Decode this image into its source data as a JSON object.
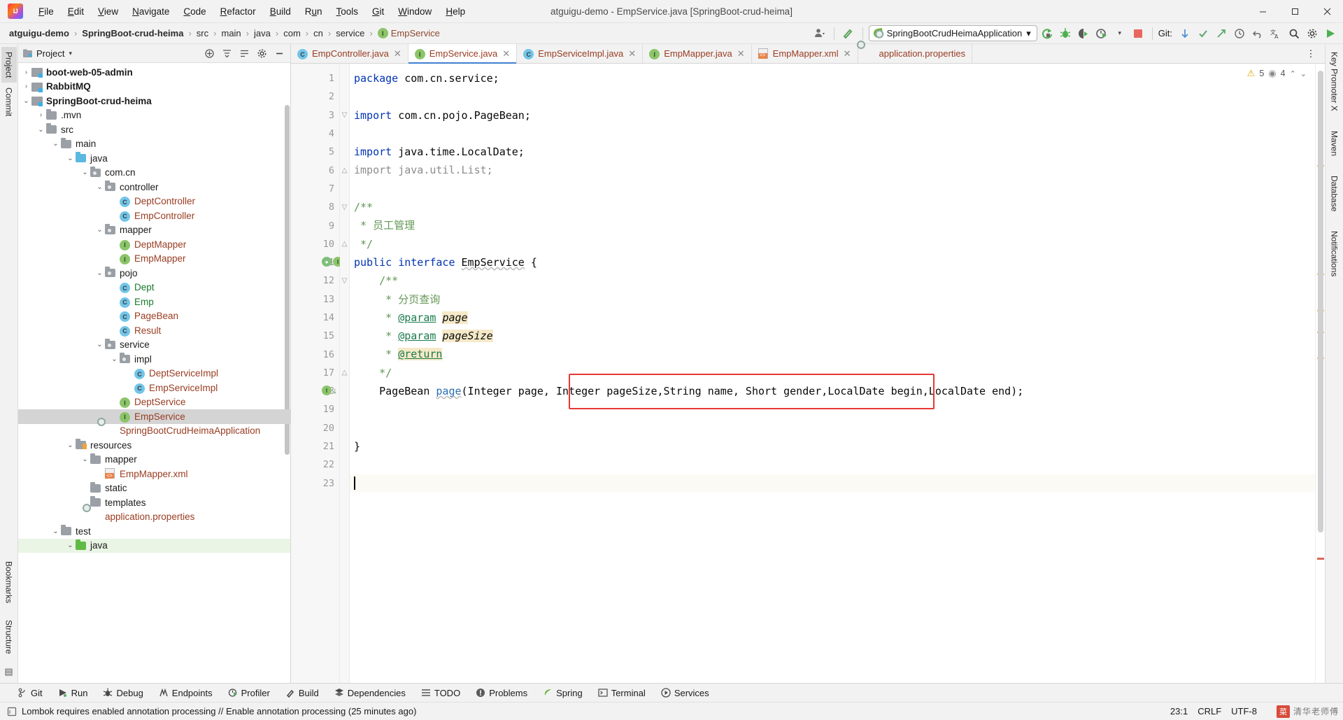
{
  "window": {
    "title": "atguigu-demo - EmpService.java [SpringBoot-crud-heima]",
    "minimize": "—",
    "maximize": "▢",
    "close": "✕"
  },
  "menubar": {
    "items": [
      {
        "label": "File",
        "mnemonic": "F"
      },
      {
        "label": "Edit",
        "mnemonic": "E"
      },
      {
        "label": "View",
        "mnemonic": "V"
      },
      {
        "label": "Navigate",
        "mnemonic": "N"
      },
      {
        "label": "Code",
        "mnemonic": "C"
      },
      {
        "label": "Refactor",
        "mnemonic": "R"
      },
      {
        "label": "Build",
        "mnemonic": "B"
      },
      {
        "label": "Run",
        "mnemonic": "u"
      },
      {
        "label": "Tools",
        "mnemonic": "T"
      },
      {
        "label": "Git",
        "mnemonic": "G"
      },
      {
        "label": "Window",
        "mnemonic": "W"
      },
      {
        "label": "Help",
        "mnemonic": "H"
      }
    ]
  },
  "navbar": {
    "crumbs": [
      {
        "label": "atguigu-demo",
        "bold": true,
        "icon": null
      },
      {
        "label": "SpringBoot-crud-heima",
        "bold": true,
        "icon": null
      },
      {
        "label": "src",
        "bold": false,
        "icon": null
      },
      {
        "label": "main",
        "bold": false,
        "icon": null
      },
      {
        "label": "java",
        "bold": false,
        "icon": null
      },
      {
        "label": "com",
        "bold": false,
        "icon": null
      },
      {
        "label": "cn",
        "bold": false,
        "icon": null
      },
      {
        "label": "service",
        "bold": false,
        "icon": null
      },
      {
        "label": "EmpService",
        "bold": false,
        "icon": "interface-badge",
        "classname": true
      }
    ],
    "separator": "›",
    "run_config": "SpringBootCrudHeimaApplication",
    "run_config_caret": "▾",
    "git_label": "Git:",
    "icons": {
      "user": "user-icon",
      "hammer": "build-hammer-icon",
      "rerun": "rerun-icon",
      "debug": "debug-bug-icon",
      "coverage": "run-with-coverage-icon",
      "profiler": "profiler-icon",
      "stop": "stop-icon",
      "git_update": "git-update-icon",
      "git_commit": "git-commit-check-icon",
      "git_push": "git-push-icon",
      "history": "history-icon",
      "undo": "undo-icon",
      "translate": "translate-icon",
      "search": "search-everywhere-icon",
      "settings": "settings-gear-icon",
      "run_green": "run-green-icon"
    }
  },
  "left_strip": {
    "tabs": [
      "Project",
      "Commit"
    ],
    "active": "Project",
    "bottom": [
      "Bookmarks",
      "Structure"
    ]
  },
  "right_strip": {
    "tabs": [
      "Key Promoter X",
      "Maven",
      "Database",
      "Notifications"
    ]
  },
  "project_panel": {
    "title": "Project",
    "caret": "▾",
    "header_icons": [
      "expand-all-icon",
      "collapse-all-icon",
      "select-opened-file-icon",
      "settings-gear-icon",
      "hide-icon"
    ],
    "tree": [
      {
        "label": "boot-web-05-admin",
        "depth": 1,
        "arrow": "›",
        "icon": "module",
        "style": "bold"
      },
      {
        "label": "RabbitMQ",
        "depth": 1,
        "arrow": "›",
        "icon": "module",
        "style": "bold"
      },
      {
        "label": "SpringBoot-crud-heima",
        "depth": 1,
        "arrow": "⌄",
        "icon": "module",
        "style": "bold"
      },
      {
        "label": ".mvn",
        "depth": 2,
        "arrow": "›",
        "icon": "folder",
        "style": "dark"
      },
      {
        "label": "src",
        "depth": 2,
        "arrow": "⌄",
        "icon": "folder",
        "style": "dark"
      },
      {
        "label": "main",
        "depth": 3,
        "arrow": "⌄",
        "icon": "folder",
        "style": "dark"
      },
      {
        "label": "java",
        "depth": 4,
        "arrow": "⌄",
        "icon": "folder-blue",
        "style": "dark"
      },
      {
        "label": "com.cn",
        "depth": 5,
        "arrow": "⌄",
        "icon": "package",
        "style": "dark"
      },
      {
        "label": "controller",
        "depth": 6,
        "arrow": "⌄",
        "icon": "package",
        "style": "dark"
      },
      {
        "label": "DeptController",
        "depth": 7,
        "arrow": "",
        "icon": "class",
        "style": "brown"
      },
      {
        "label": "EmpController",
        "depth": 7,
        "arrow": "",
        "icon": "class",
        "style": "brown"
      },
      {
        "label": "mapper",
        "depth": 6,
        "arrow": "⌄",
        "icon": "package",
        "style": "dark"
      },
      {
        "label": "DeptMapper",
        "depth": 7,
        "arrow": "",
        "icon": "interface",
        "style": "brown"
      },
      {
        "label": "EmpMapper",
        "depth": 7,
        "arrow": "",
        "icon": "interface",
        "style": "brown"
      },
      {
        "label": "pojo",
        "depth": 6,
        "arrow": "⌄",
        "icon": "package",
        "style": "dark"
      },
      {
        "label": "Dept",
        "depth": 7,
        "arrow": "",
        "icon": "class",
        "style": "green"
      },
      {
        "label": "Emp",
        "depth": 7,
        "arrow": "",
        "icon": "class",
        "style": "green"
      },
      {
        "label": "PageBean",
        "depth": 7,
        "arrow": "",
        "icon": "class",
        "style": "brown"
      },
      {
        "label": "Result",
        "depth": 7,
        "arrow": "",
        "icon": "class",
        "style": "brown"
      },
      {
        "label": "service",
        "depth": 6,
        "arrow": "⌄",
        "icon": "package",
        "style": "dark"
      },
      {
        "label": "impl",
        "depth": 7,
        "arrow": "⌄",
        "icon": "package",
        "style": "dark"
      },
      {
        "label": "DeptServiceImpl",
        "depth": 8,
        "arrow": "",
        "icon": "class",
        "style": "brown"
      },
      {
        "label": "EmpServiceImpl",
        "depth": 8,
        "arrow": "",
        "icon": "class",
        "style": "brown"
      },
      {
        "label": "DeptService",
        "depth": 7,
        "arrow": "",
        "icon": "interface",
        "style": "brown"
      },
      {
        "label": "EmpService",
        "depth": 7,
        "arrow": "",
        "icon": "interface",
        "style": "brown",
        "selected": true
      },
      {
        "label": "SpringBootCrudHeimaApplication",
        "depth": 6,
        "arrow": "",
        "icon": "spring",
        "style": "brown"
      },
      {
        "label": "resources",
        "depth": 4,
        "arrow": "⌄",
        "icon": "resources",
        "style": "dark"
      },
      {
        "label": "mapper",
        "depth": 5,
        "arrow": "⌄",
        "icon": "folder",
        "style": "dark"
      },
      {
        "label": "EmpMapper.xml",
        "depth": 6,
        "arrow": "",
        "icon": "xml",
        "style": "brown"
      },
      {
        "label": "static",
        "depth": 5,
        "arrow": "",
        "icon": "folder",
        "style": "dark"
      },
      {
        "label": "templates",
        "depth": 5,
        "arrow": "",
        "icon": "folder",
        "style": "dark"
      },
      {
        "label": "application.properties",
        "depth": 5,
        "arrow": "",
        "icon": "spring",
        "style": "brown"
      },
      {
        "label": "test",
        "depth": 3,
        "arrow": "⌄",
        "icon": "folder",
        "style": "dark"
      },
      {
        "label": "java",
        "depth": 4,
        "arrow": "⌄",
        "icon": "folder-green",
        "style": "dark",
        "green_row": true
      }
    ]
  },
  "editor": {
    "tabs": [
      {
        "label": "EmpController.java",
        "icon": "class",
        "active": false,
        "close": "✕"
      },
      {
        "label": "EmpService.java",
        "icon": "interface",
        "active": true,
        "close": "✕"
      },
      {
        "label": "EmpServiceImpl.java",
        "icon": "class",
        "active": false,
        "close": "✕"
      },
      {
        "label": "EmpMapper.java",
        "icon": "interface",
        "active": false,
        "close": "✕"
      },
      {
        "label": "EmpMapper.xml",
        "icon": "xml",
        "active": false,
        "close": "✕"
      },
      {
        "label": "application.properties",
        "icon": "spring",
        "active": false,
        "close": ""
      }
    ],
    "more_icon": "⋮",
    "inspections": {
      "warning_icon": "⚠",
      "warning_count": "5",
      "weak_icon": "◉",
      "weak_count": "4",
      "up_arrow": "⌃",
      "down_arrow": "⌄"
    },
    "line_numbers": [
      "1",
      "2",
      "3",
      "4",
      "5",
      "6",
      "7",
      "8",
      "9",
      "10",
      "11",
      "12",
      "13",
      "14",
      "15",
      "16",
      "17",
      "18",
      "19",
      "20",
      "21",
      "22",
      "23"
    ],
    "lines": [
      {
        "n": 1,
        "text": "package com.cn.service;"
      },
      {
        "n": 2,
        "text": ""
      },
      {
        "n": 3,
        "text": "import com.cn.pojo.PageBean;"
      },
      {
        "n": 4,
        "text": ""
      },
      {
        "n": 5,
        "text": "import java.time.LocalDate;"
      },
      {
        "n": 6,
        "text": "import java.util.List;"
      },
      {
        "n": 7,
        "text": ""
      },
      {
        "n": 8,
        "text": "/**"
      },
      {
        "n": 9,
        "text": " * 员工管理"
      },
      {
        "n": 10,
        "text": " */"
      },
      {
        "n": 11,
        "text": "public interface EmpService {"
      },
      {
        "n": 12,
        "text": "    /**"
      },
      {
        "n": 13,
        "text": "     * 分页查询"
      },
      {
        "n": 14,
        "text": "     * @param page"
      },
      {
        "n": 15,
        "text": "     * @param pageSize"
      },
      {
        "n": 16,
        "text": "     * @return"
      },
      {
        "n": 17,
        "text": "     */"
      },
      {
        "n": 18,
        "text": "    PageBean page(Integer page, Integer pageSize,String name, Short gender,LocalDate begin,LocalDate end);"
      },
      {
        "n": 19,
        "text": ""
      },
      {
        "n": 20,
        "text": ""
      },
      {
        "n": 21,
        "text": "}"
      },
      {
        "n": 22,
        "text": ""
      },
      {
        "n": 23,
        "text": ""
      }
    ],
    "highlight_box": {
      "text": "String name, Short gender,LocalDate begin,LocalDate end);",
      "color": "#e53935"
    }
  },
  "tool_window_bar": {
    "buttons": [
      {
        "label": "Git",
        "icon": "git-branch-icon"
      },
      {
        "label": "Run",
        "icon": "run-icon"
      },
      {
        "label": "Debug",
        "icon": "debug-icon"
      },
      {
        "label": "Endpoints",
        "icon": "endpoints-icon"
      },
      {
        "label": "Profiler",
        "icon": "profiler-icon"
      },
      {
        "label": "Build",
        "icon": "build-hammer-icon"
      },
      {
        "label": "Dependencies",
        "icon": "dependencies-icon"
      },
      {
        "label": "TODO",
        "icon": "todo-icon"
      },
      {
        "label": "Problems",
        "icon": "problems-icon"
      },
      {
        "label": "Spring",
        "icon": "spring-leaf-icon"
      },
      {
        "label": "Terminal",
        "icon": "terminal-icon"
      },
      {
        "label": "Services",
        "icon": "services-icon"
      }
    ]
  },
  "statusbar": {
    "message_icon": "notification-icon",
    "message": "Lombok requires enabled annotation processing // Enable annotation processing (25 minutes ago)",
    "caret_position": "23:1",
    "line_separator": "CRLF",
    "encoding": "UTF-8",
    "watermark_badge": "菜",
    "watermark_text": "清华老师傅"
  }
}
